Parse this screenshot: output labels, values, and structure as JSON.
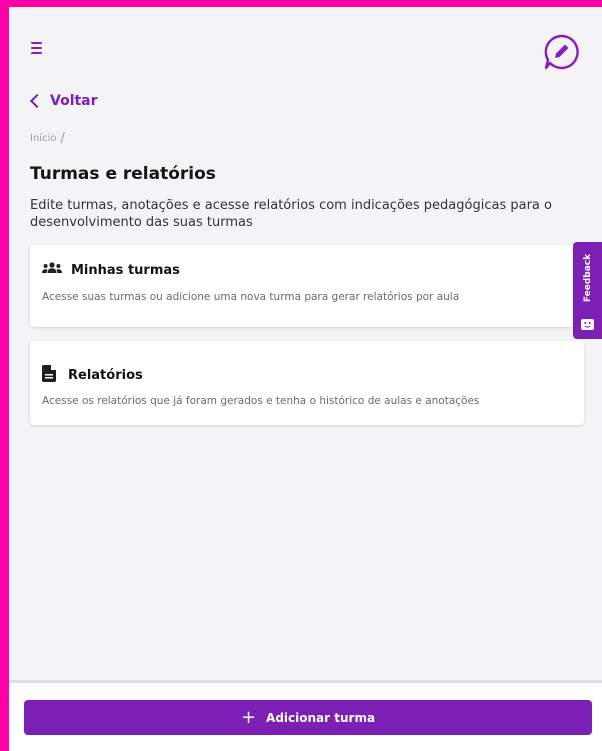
{
  "header": {
    "menu_icon": "hamburger-menu-icon",
    "edit_icon": "pencil-chat-icon"
  },
  "nav": {
    "back_label": "Voltar",
    "breadcrumb_home": "Início",
    "breadcrumb_sep": "/"
  },
  "page": {
    "title": "Turmas e relatórios",
    "description": "Edite turmas, anotações e acesse relatórios com indicações pedagógicas para o desenvolvimento das suas turmas"
  },
  "cards": [
    {
      "icon": "users-group-icon",
      "title": "Minhas turmas",
      "description": "Acesse suas turmas ou adicione uma nova turma para gerar relatórios por aula"
    },
    {
      "icon": "document-icon",
      "title": "Relatórios",
      "description": "Acesse os relatórios que já foram gerados e tenha o histórico de aulas e anotações"
    }
  ],
  "feedback": {
    "label": "Feedback",
    "icon": "feedback-face-icon"
  },
  "footer": {
    "add_button_label": "Adicionar turma",
    "add_icon": "plus-icon"
  },
  "colors": {
    "accent": "#7b1fb5",
    "frame": "#ff00a8",
    "background": "#f4f4f6"
  }
}
